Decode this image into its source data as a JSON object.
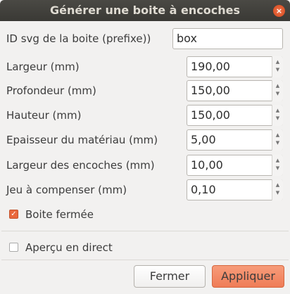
{
  "title": "Générer une boite à encoches",
  "fields": {
    "id": {
      "label": "ID svg de la boite (prefixe))",
      "value": "box"
    },
    "largeur": {
      "label": "Largeur (mm)",
      "value": "190,00"
    },
    "profondeur": {
      "label": "Profondeur (mm)",
      "value": "150,00"
    },
    "hauteur": {
      "label": "Hauteur (mm)",
      "value": "150,00"
    },
    "epaisseur": {
      "label": "Epaisseur du matériau (mm)",
      "value": "5,00"
    },
    "encoches": {
      "label": "Largeur des encoches (mm)",
      "value": "10,00"
    },
    "jeu": {
      "label": "Jeu à compenser (mm)",
      "value": "0,10"
    }
  },
  "closed_box": {
    "label": "Boite fermée",
    "checked": true
  },
  "live_preview": {
    "label": "Aperçu en direct",
    "checked": false
  },
  "buttons": {
    "close": "Fermer",
    "apply": "Appliquer"
  },
  "accent": "#ef7c57"
}
